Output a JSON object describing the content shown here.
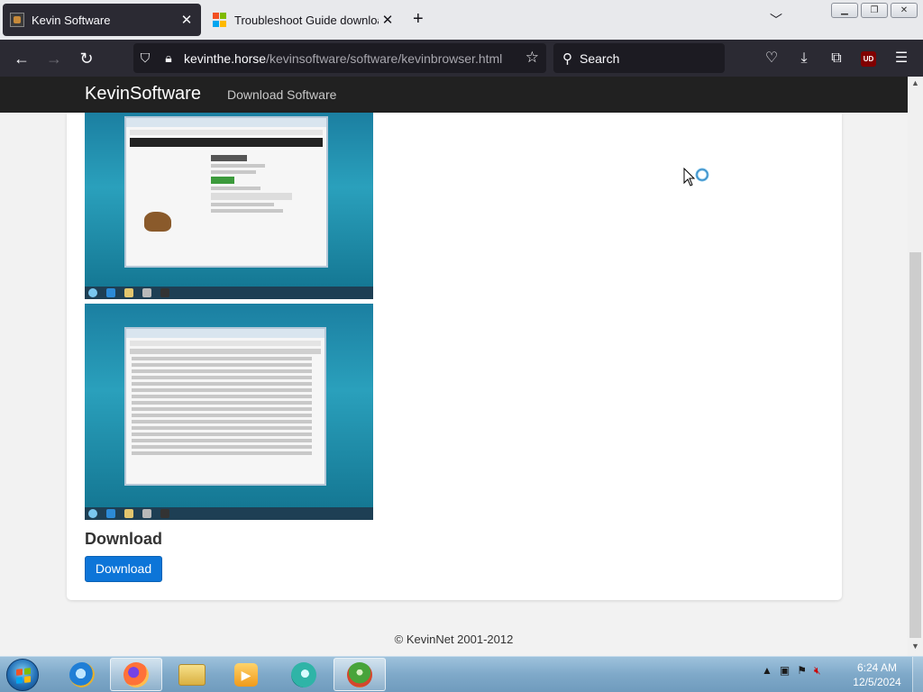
{
  "browser": {
    "tabs": [
      {
        "title": "Kevin Software",
        "active": true
      },
      {
        "title": "Troubleshoot Guide downloading",
        "active": false
      }
    ],
    "url_host": "kevinthe.horse",
    "url_path": "/kevinsoftware/software/kevinbrowser.html",
    "search_placeholder": "Search",
    "ublock_label": "UD"
  },
  "site": {
    "brand": "KevinSoftware",
    "nav_link": "Download Software",
    "download_heading": "Download",
    "download_button": "Download",
    "footer": "© KevinNet 2001-2012"
  },
  "taskbar": {
    "time": "6:24 AM",
    "date": "12/5/2024"
  },
  "colors": {
    "accent_button": "#0d75d8",
    "site_nav_bg": "#212121",
    "browser_chrome": "#2b2a33"
  }
}
